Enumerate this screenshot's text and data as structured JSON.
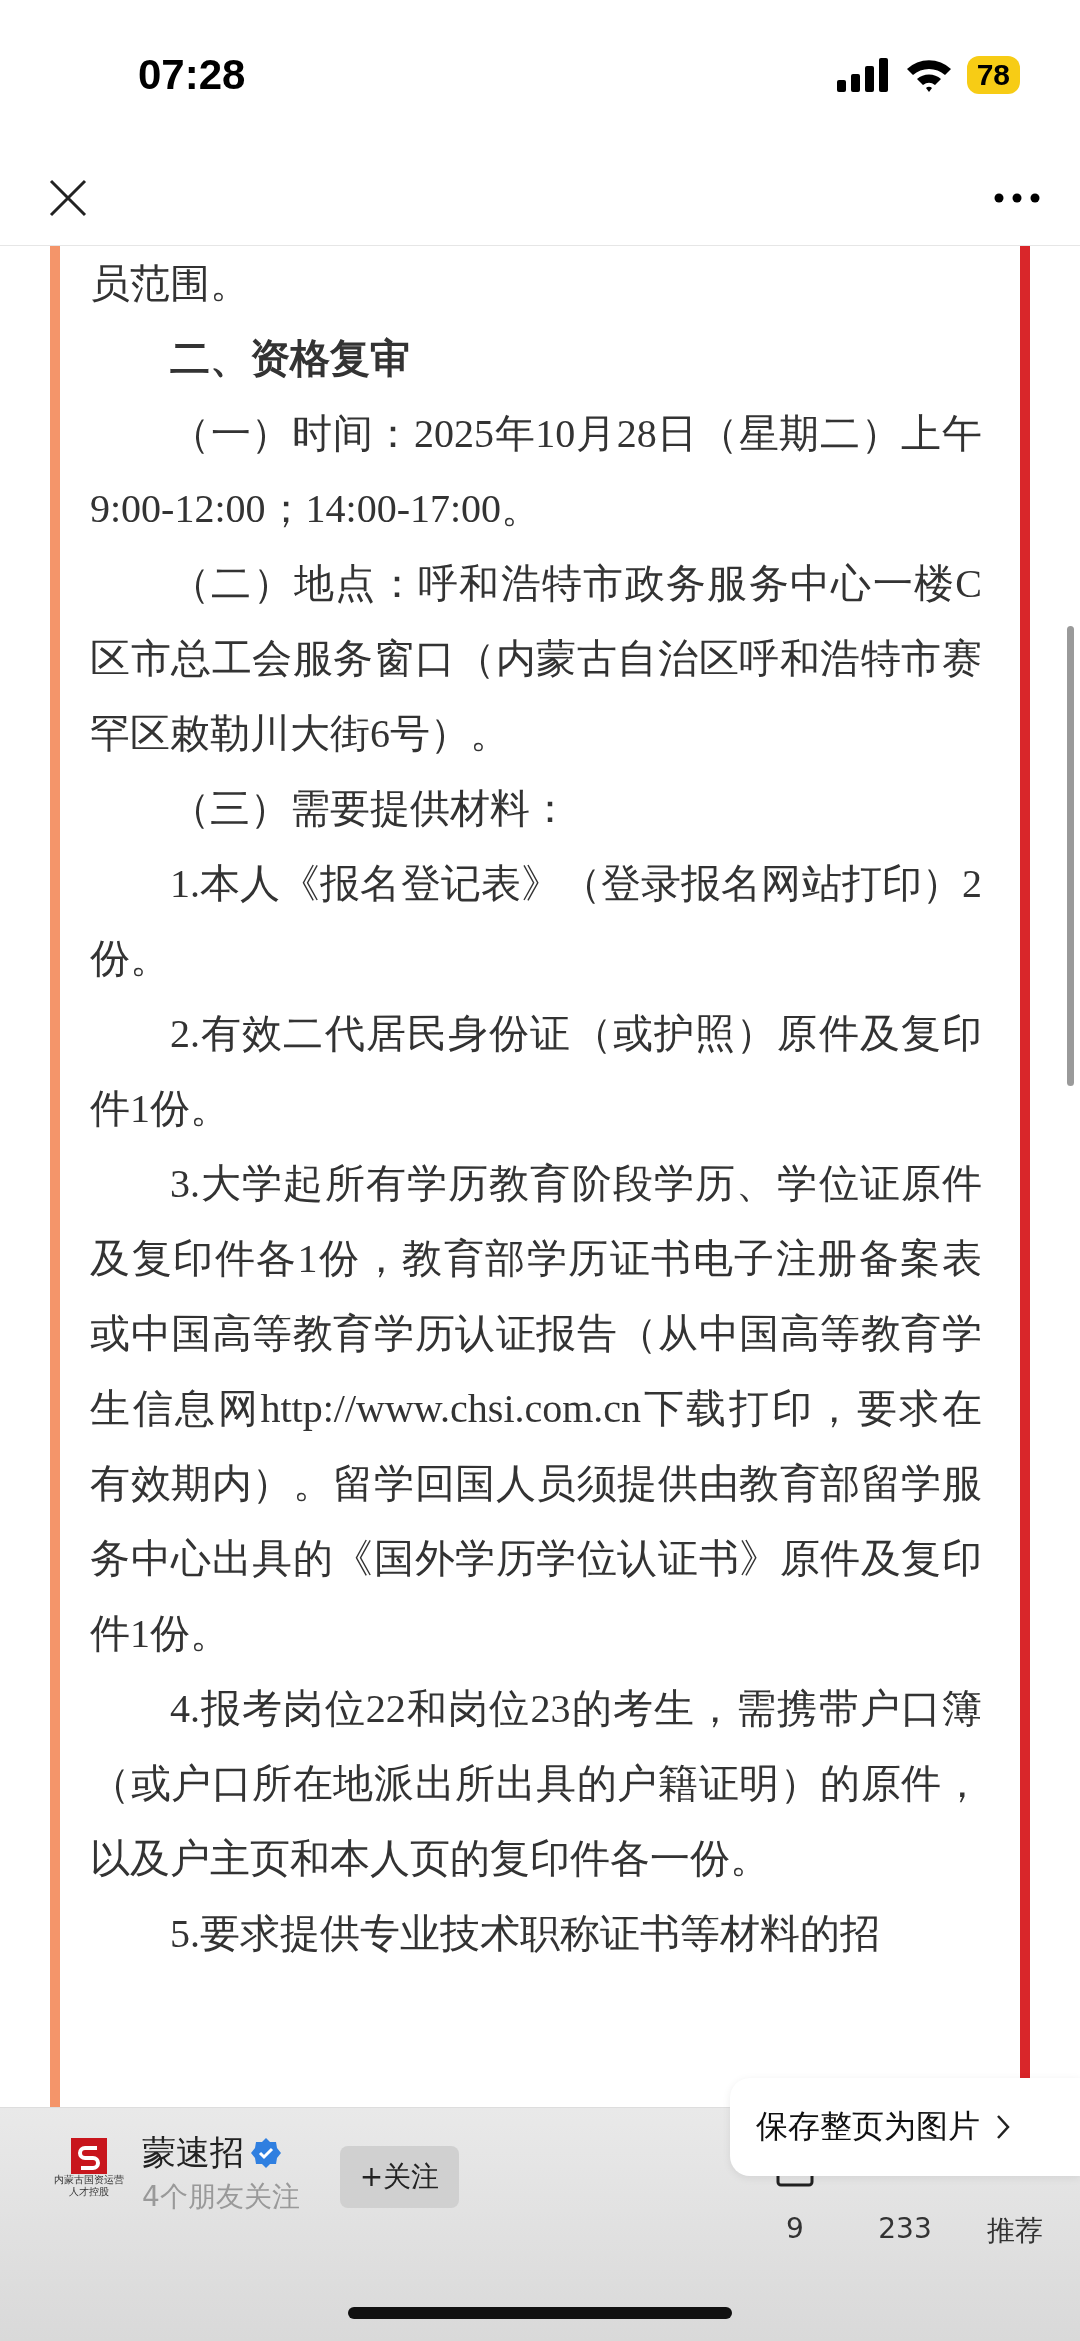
{
  "status_bar": {
    "time": "07:28",
    "battery": "78"
  },
  "article": {
    "paragraphs": [
      {
        "kind": "text",
        "text": "员范围。",
        "indent": false
      },
      {
        "kind": "heading",
        "text": "二、资格复审",
        "indent": true
      },
      {
        "kind": "text",
        "text": "（一）时间：2025年10月28日（星期二）上午9:00-12:00；14:00-17:00。",
        "indent": true
      },
      {
        "kind": "text",
        "text": "（二）地点：呼和浩特市政务服务中心一楼C区市总工会服务窗口（内蒙古自治区呼和浩特市赛罕区敕勒川大街6号）。",
        "indent": true
      },
      {
        "kind": "text",
        "text": "（三）需要提供材料：",
        "indent": true
      },
      {
        "kind": "text",
        "text": "1.本人《报名登记表》（登录报名网站打印）2份。",
        "indent": true
      },
      {
        "kind": "text",
        "text": "2.有效二代居民身份证（或护照）原件及复印件1份。",
        "indent": true
      },
      {
        "kind": "text",
        "text": "3.大学起所有学历教育阶段学历、学位证原件及复印件各1份，教育部学历证书电子注册备案表或中国高等教育学历认证报告（从中国高等教育学生信息网http://www.chsi.com.cn下载打印，要求在有效期内）。留学回国人员须提供由教育部留学服务中心出具的《国外学历学位认证书》原件及复印件1份。",
        "indent": true
      },
      {
        "kind": "text",
        "text": "4.报考岗位22和岗位23的考生，需携带户口簿（或户口所在地派出所出具的户籍证明）的原件，以及户主页和本人页的复印件各一份。",
        "indent": true
      },
      {
        "kind": "text",
        "text": "5.要求提供专业技术职称证书等材料的招",
        "indent": true
      }
    ]
  },
  "footer": {
    "logo_text": [
      "内蒙古国资运营",
      "人才控股"
    ],
    "account_name": "蒙速招",
    "verified": true,
    "followers": "4个朋友关注",
    "follow_button": "+关注",
    "stats": [
      {
        "kind": "comments",
        "label": "9"
      },
      {
        "kind": "likes",
        "label": "233"
      },
      {
        "kind": "recommend",
        "label": "推荐"
      }
    ],
    "popup": "保存整页为图片"
  }
}
